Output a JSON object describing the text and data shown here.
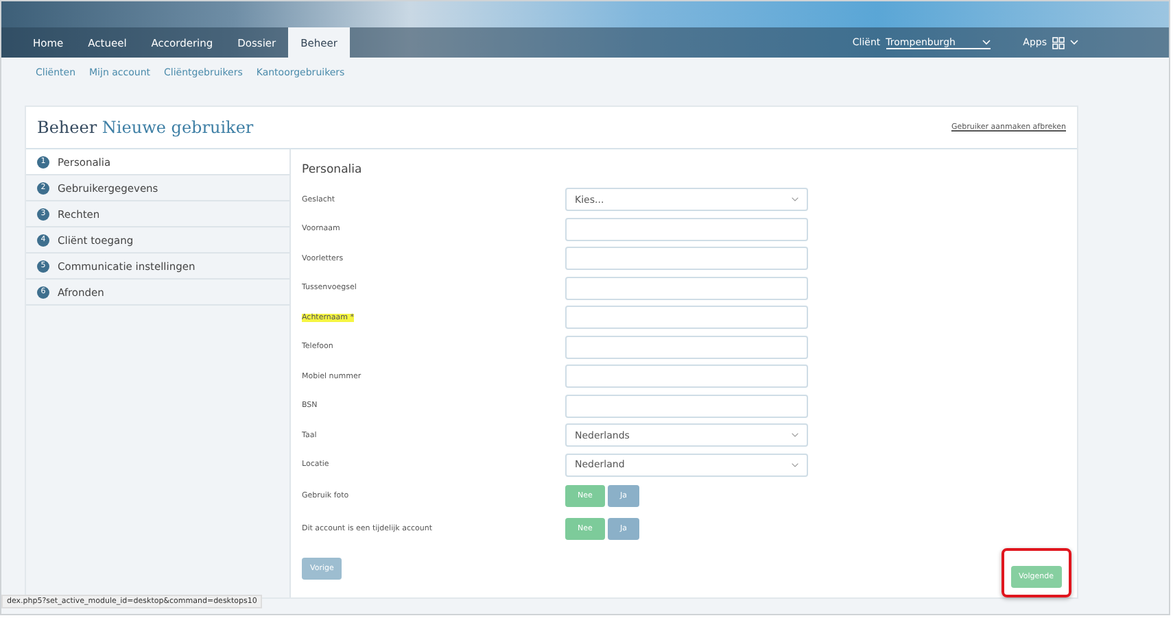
{
  "nav": {
    "tabs": [
      {
        "label": "Home",
        "selected": false
      },
      {
        "label": "Actueel",
        "selected": false
      },
      {
        "label": "Accordering",
        "selected": false
      },
      {
        "label": "Dossier",
        "selected": false
      },
      {
        "label": "Beheer",
        "selected": true
      }
    ],
    "client_label": "Cliënt",
    "client_value": "Trompenburgh",
    "apps_label": "Apps"
  },
  "subnav": [
    "Cliënten",
    "Mijn account",
    "Cliëntgebruikers",
    "Kantoorgebruikers"
  ],
  "page": {
    "title_prefix": "Beheer",
    "title": "Nieuwe gebruiker",
    "cancel_link": "Gebruiker aanmaken afbreken"
  },
  "steps": [
    {
      "number": "1",
      "label": "Personalia",
      "selected": true
    },
    {
      "number": "2",
      "label": "Gebruikergegevens",
      "selected": false
    },
    {
      "number": "3",
      "label": "Rechten",
      "selected": false
    },
    {
      "number": "4",
      "label": "Cliënt toegang",
      "selected": false
    },
    {
      "number": "5",
      "label": "Communicatie instellingen",
      "selected": false
    },
    {
      "number": "6",
      "label": "Afronden",
      "selected": false
    }
  ],
  "form": {
    "heading": "Personalia",
    "fields": [
      {
        "kind": "select",
        "label": "Geslacht",
        "value": "Kies...",
        "highlighted": false
      },
      {
        "kind": "text",
        "label": "Voornaam",
        "highlighted": false
      },
      {
        "kind": "text",
        "label": "Voorletters",
        "highlighted": false
      },
      {
        "kind": "text",
        "label": "Tussenvoegsel",
        "highlighted": false
      },
      {
        "kind": "text",
        "label": "Achternaam *",
        "highlighted": true
      },
      {
        "kind": "text",
        "label": "Telefoon",
        "highlighted": false
      },
      {
        "kind": "text",
        "label": "Mobiel nummer",
        "highlighted": false
      },
      {
        "kind": "text",
        "label": "BSN",
        "highlighted": false
      },
      {
        "kind": "select",
        "label": "Taal",
        "value": "Nederlands",
        "highlighted": false
      },
      {
        "kind": "select",
        "label": "Locatie",
        "value": "Nederland",
        "highlighted": false
      },
      {
        "kind": "toggle",
        "label": "Gebruik foto",
        "highlighted": false,
        "options": [
          {
            "label": "Nee",
            "selected": true
          },
          {
            "label": "Ja",
            "selected": false
          }
        ]
      },
      {
        "kind": "toggle",
        "label": "Dit account is een tijdelijk account",
        "highlighted": false,
        "options": [
          {
            "label": "Nee",
            "selected": true
          },
          {
            "label": "Ja",
            "selected": false
          }
        ]
      }
    ],
    "back_button": "Vorige",
    "next_button": "Volgende",
    "next_highlighted": true
  },
  "status_bar": "dex.php5?set_active_module_id=desktop&command=desktops10"
}
